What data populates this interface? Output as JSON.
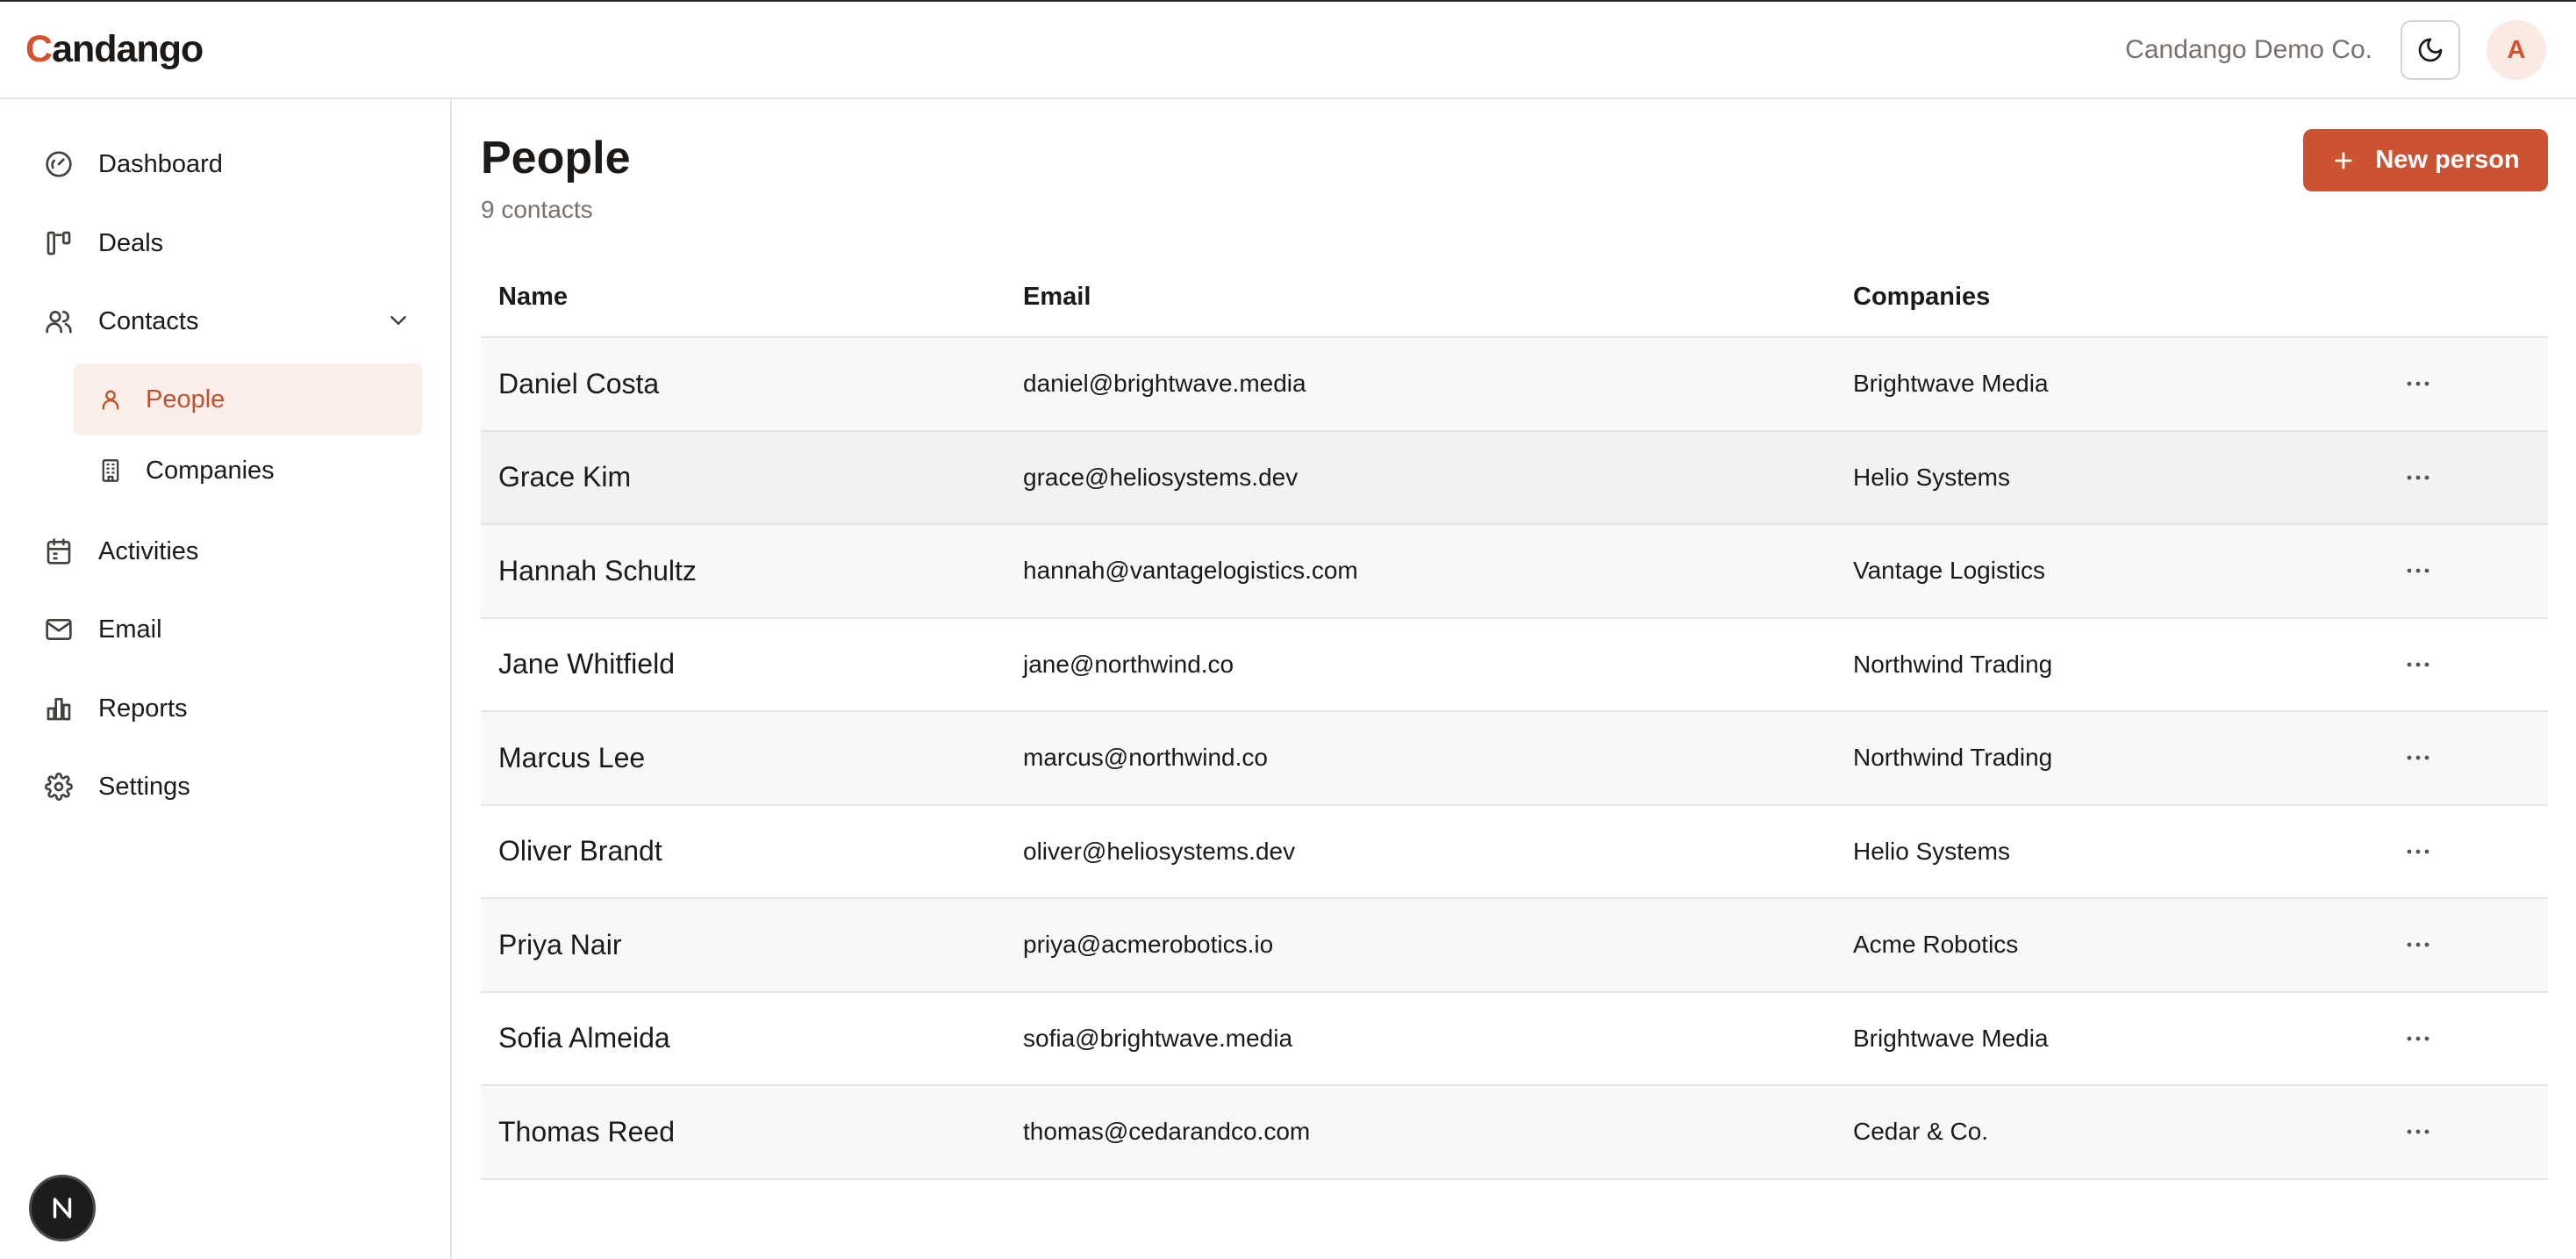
{
  "app": {
    "logo_first": "C",
    "logo_rest": "andango",
    "org_name": "Candango Demo Co.",
    "avatar_initial": "A",
    "accent_color": "#cc5331"
  },
  "sidebar": {
    "items": [
      {
        "label": "Dashboard",
        "icon": "gauge-icon"
      },
      {
        "label": "Deals",
        "icon": "kanban-icon"
      },
      {
        "label": "Contacts",
        "icon": "users-icon"
      },
      {
        "label": "Activities",
        "icon": "calendar-icon"
      },
      {
        "label": "Email",
        "icon": "mail-icon"
      },
      {
        "label": "Reports",
        "icon": "bar-chart-icon"
      },
      {
        "label": "Settings",
        "icon": "gear-icon"
      }
    ],
    "contacts_sub": [
      {
        "label": "People",
        "icon": "user-icon",
        "active": true
      },
      {
        "label": "Companies",
        "icon": "building-icon",
        "active": false
      }
    ],
    "next_badge": "N"
  },
  "main": {
    "title": "People",
    "subtitle": "9 contacts",
    "new_button_label": "New person",
    "columns": {
      "name": "Name",
      "email": "Email",
      "companies": "Companies"
    },
    "rows": [
      {
        "name": "Daniel Costa",
        "email": "daniel@brightwave.media",
        "company": "Brightwave Media"
      },
      {
        "name": "Grace Kim",
        "email": "grace@heliosystems.dev",
        "company": "Helio Systems"
      },
      {
        "name": "Hannah Schultz",
        "email": "hannah@vantagelogistics.com",
        "company": "Vantage Logistics"
      },
      {
        "name": "Jane Whitfield",
        "email": "jane@northwind.co",
        "company": "Northwind Trading"
      },
      {
        "name": "Marcus Lee",
        "email": "marcus@northwind.co",
        "company": "Northwind Trading"
      },
      {
        "name": "Oliver Brandt",
        "email": "oliver@heliosystems.dev",
        "company": "Helio Systems"
      },
      {
        "name": "Priya Nair",
        "email": "priya@acmerobotics.io",
        "company": "Acme Robotics"
      },
      {
        "name": "Sofia Almeida",
        "email": "sofia@brightwave.media",
        "company": "Brightwave Media"
      },
      {
        "name": "Thomas Reed",
        "email": "thomas@cedarandco.com",
        "company": "Cedar & Co."
      }
    ]
  }
}
